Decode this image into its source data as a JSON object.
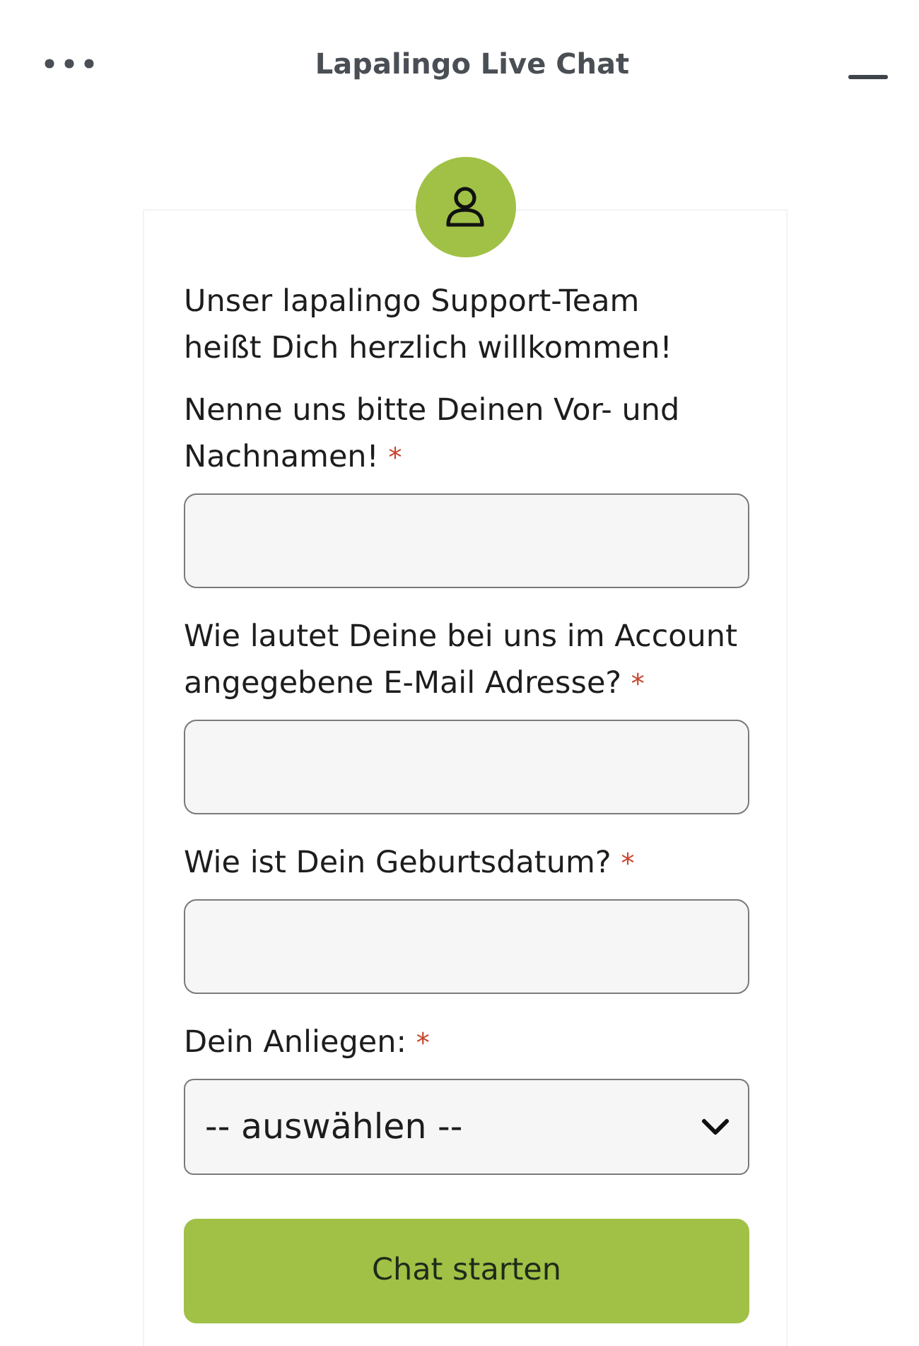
{
  "header": {
    "title": "Lapalingo Live Chat"
  },
  "form": {
    "intro": "Unser lapalingo Support-Team heißt Dich herzlich willkommen!",
    "fields": [
      {
        "kind": "text",
        "label": "Nenne uns bitte Deinen Vor- und Nachnamen!",
        "required_mark": "*"
      },
      {
        "kind": "text",
        "label": "Wie lautet Deine bei uns im Account angegebene E-Mail Adresse?",
        "required_mark": "*"
      },
      {
        "kind": "text",
        "label": "Wie ist Dein Geburtsdatum?",
        "required_mark": "*"
      },
      {
        "kind": "select",
        "label": "Dein Anliegen:",
        "required_mark": "*",
        "value": "-- auswählen --"
      }
    ],
    "submit_button": {
      "label": "Chat starten"
    }
  }
}
